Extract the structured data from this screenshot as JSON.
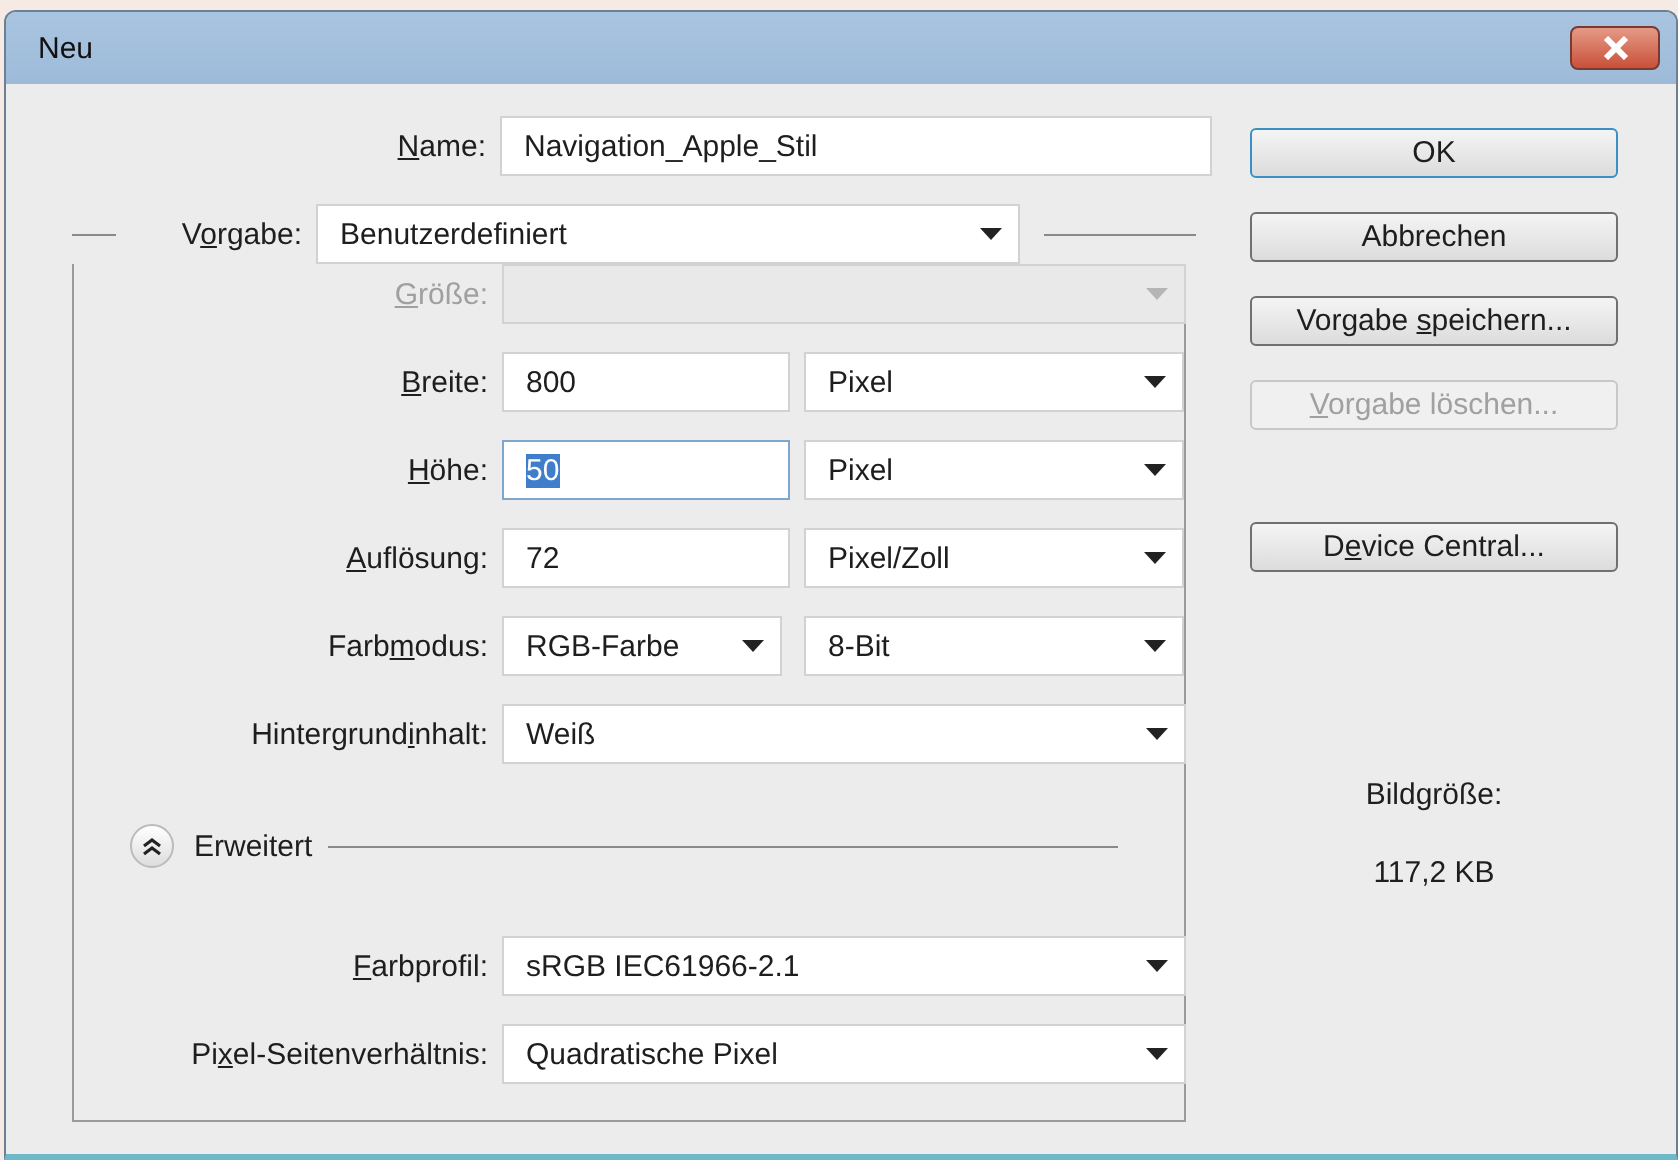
{
  "window": {
    "title": "Neu"
  },
  "name_field": {
    "label": {
      "key": "N",
      "post": "ame:"
    },
    "value": "Navigation_Apple_Stil"
  },
  "preset": {
    "label": {
      "pre": "V",
      "key": "o",
      "post": "rgabe:"
    },
    "value": "Benutzerdefiniert"
  },
  "rows": [
    {
      "kind": "combo",
      "label": {
        "key": "G",
        "post": "röße:"
      },
      "disabled": true
    },
    {
      "kind": "input_unit",
      "label": {
        "key": "B",
        "post": "reite:"
      },
      "value": "800",
      "highlighted": false,
      "unit": "Pixel"
    },
    {
      "kind": "input_unit",
      "label": {
        "key": "H",
        "post": "öhe:"
      },
      "value": "50",
      "highlighted": true,
      "unit": "Pixel"
    },
    {
      "kind": "input_unit",
      "label": {
        "key": "A",
        "post": "uflösung:"
      },
      "value": "72",
      "highlighted": false,
      "unit": "Pixel/Zoll"
    },
    {
      "kind": "combo_pair",
      "label": {
        "pre": "Farb",
        "key": "m",
        "post": "odus:"
      },
      "value": "RGB-Farbe",
      "unit": "8-Bit"
    },
    {
      "kind": "combo",
      "label": {
        "pre": "Hintergrund",
        "key": "i",
        "post": "nhalt:"
      },
      "value": "Weiß",
      "disabled": false
    }
  ],
  "advanced": {
    "label": "Erweitert",
    "expanded": true,
    "rows": [
      {
        "kind": "combo",
        "label": {
          "key": "F",
          "post": "arbprofil:"
        },
        "value": "sRGB IEC61966-2.1",
        "disabled": false
      },
      {
        "kind": "combo",
        "label": {
          "pre": "Pi",
          "key": "x",
          "post": "el-Seitenverhältnis:"
        },
        "value": "Quadratische Pixel",
        "disabled": false
      }
    ]
  },
  "buttons": [
    {
      "label": {
        "post": "OK"
      },
      "default": true,
      "disabled": false
    },
    {
      "label": {
        "post": "Abbrechen"
      },
      "default": false,
      "disabled": false
    },
    {
      "label": {
        "pre": "Vorgabe ",
        "key": "s",
        "post": "peichern..."
      },
      "default": false,
      "disabled": false
    },
    {
      "label": {
        "key": "V",
        "post": "orgabe löschen..."
      },
      "default": false,
      "disabled": true
    }
  ],
  "extra_buttons": [
    {
      "label": {
        "pre": "D",
        "key": "e",
        "post": "vice Central..."
      },
      "default": false,
      "disabled": false
    }
  ],
  "info": {
    "label": "Bildgröße:",
    "value": "117,2 KB"
  }
}
